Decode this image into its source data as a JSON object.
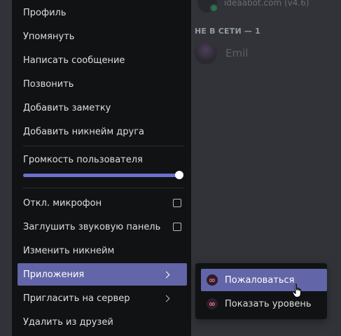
{
  "background": {
    "top_member_text": "ideaabot.com (v4.6)",
    "section_header": "НЕ В СЕТИ — 1",
    "member_name": "Emil"
  },
  "menu": {
    "items": {
      "profile": "Профиль",
      "mention": "Упомянуть",
      "message": "Написать сообщение",
      "call": "Позвонить",
      "add_note": "Добавить заметку",
      "add_friend_nickname": "Добавить никнейм друга",
      "mute_mic": "Откл. микрофон",
      "mute_soundboard": "Заглушить звуковую панель",
      "change_nickname": "Изменить никнейм",
      "apps": "Приложения",
      "invite_server": "Пригласить на сервер",
      "remove_friend": "Удалить из друзей"
    },
    "volume": {
      "label": "Громкость пользователя",
      "level_percent": 100
    }
  },
  "submenu": {
    "report": "Пожаловаться",
    "show_level": "Показать уровень",
    "app_icon": "infinity-icon",
    "app_icon_glyph": "∞"
  },
  "colors": {
    "accent": "#6265a7",
    "slider_fill": "#6b6fcf",
    "menu_bg": "#111214"
  }
}
